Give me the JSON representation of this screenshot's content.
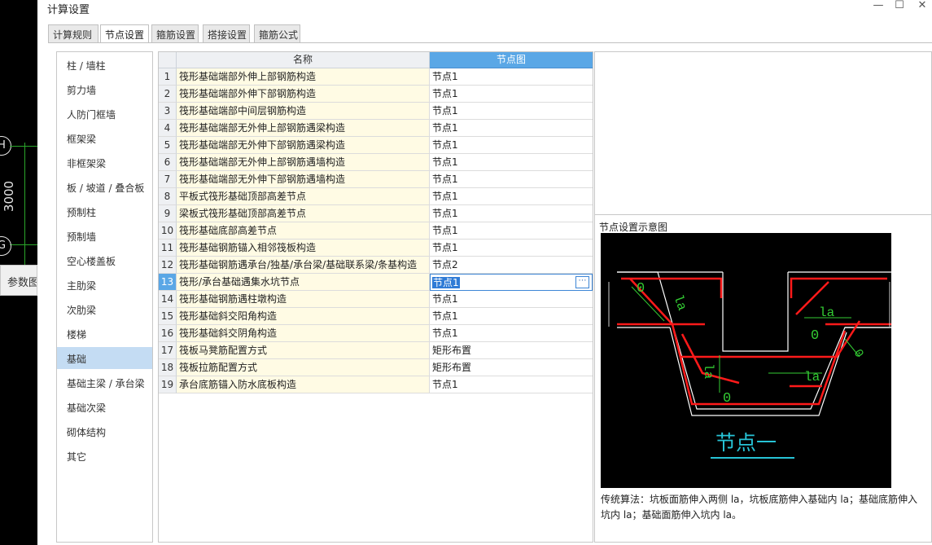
{
  "background": {
    "axis_labels": [
      "H",
      "G"
    ],
    "dimension": "3000",
    "side_tab": "参数图"
  },
  "window": {
    "title": "计算设置",
    "minimize": "—",
    "maximize": "☐",
    "close": "✕"
  },
  "tabs": [
    {
      "label": "计算规则"
    },
    {
      "label": "节点设置"
    },
    {
      "label": "箍筋设置"
    },
    {
      "label": "搭接设置"
    },
    {
      "label": "箍筋公式"
    }
  ],
  "categories": [
    "柱 / 墙柱",
    "剪力墙",
    "人防门框墙",
    "框架梁",
    "非框架梁",
    "板 / 坡道 / 叠合板",
    "预制柱",
    "预制墙",
    "空心楼盖板",
    "主肋梁",
    "次肋梁",
    "楼梯",
    "基础",
    "基础主梁 / 承台梁",
    "基础次梁",
    "砌体结构",
    "其它"
  ],
  "grid": {
    "col_name": "名称",
    "col_node": "节点图",
    "rows": [
      {
        "no": "1",
        "name": "筏形基础端部外伸上部钢筋构造",
        "value": "节点1"
      },
      {
        "no": "2",
        "name": "筏形基础端部外伸下部钢筋构造",
        "value": "节点1"
      },
      {
        "no": "3",
        "name": "筏形基础端部中间层钢筋构造",
        "value": "节点1"
      },
      {
        "no": "4",
        "name": "筏形基础端部无外伸上部钢筋遇梁构造",
        "value": "节点1"
      },
      {
        "no": "5",
        "name": "筏形基础端部无外伸下部钢筋遇梁构造",
        "value": "节点1"
      },
      {
        "no": "6",
        "name": "筏形基础端部无外伸上部钢筋遇墙构造",
        "value": "节点1"
      },
      {
        "no": "7",
        "name": "筏形基础端部无外伸下部钢筋遇墙构造",
        "value": "节点1"
      },
      {
        "no": "8",
        "name": "平板式筏形基础顶部高差节点",
        "value": "节点1"
      },
      {
        "no": "9",
        "name": "梁板式筏形基础顶部高差节点",
        "value": "节点1"
      },
      {
        "no": "10",
        "name": "筏形基础底部高差节点",
        "value": "节点1"
      },
      {
        "no": "11",
        "name": "筏形基础钢筋锚入相邻筏板构造",
        "value": "节点1"
      },
      {
        "no": "12",
        "name": "筏形基础钢筋遇承台/独基/承台梁/基础联系梁/条基构造",
        "value": "节点2"
      },
      {
        "no": "13",
        "name": "筏形/承台基础遇集水坑节点",
        "value": "节点1"
      },
      {
        "no": "14",
        "name": "筏形基础钢筋遇柱墩构造",
        "value": "节点1"
      },
      {
        "no": "15",
        "name": "筏形基础斜交阳角构造",
        "value": "节点1"
      },
      {
        "no": "16",
        "name": "筏形基础斜交阴角构造",
        "value": "节点1"
      },
      {
        "no": "17",
        "name": "筏板马凳筋配置方式",
        "value": "矩形布置"
      },
      {
        "no": "18",
        "name": "筏板拉筋配置方式",
        "value": "矩形布置"
      },
      {
        "no": "19",
        "name": "承台底筋锚入防水底板构造",
        "value": "节点1"
      }
    ],
    "ellipsis": "⋯"
  },
  "preview": {
    "title": "节点设置示意图",
    "diagram_caption": "节点一",
    "label_la": "la",
    "label_zero": "0",
    "description": "传统算法：坑板面筋伸入两侧 la，坑板底筋伸入基础内 la；基础底筋伸入坑内 la；基础面筋伸入坑内 la。",
    "colors": {
      "background": "#000000",
      "outline": "#ffffff",
      "rebar": "#ff1a1a",
      "dimension": "#33cc33",
      "caption": "#27c3d6"
    }
  }
}
